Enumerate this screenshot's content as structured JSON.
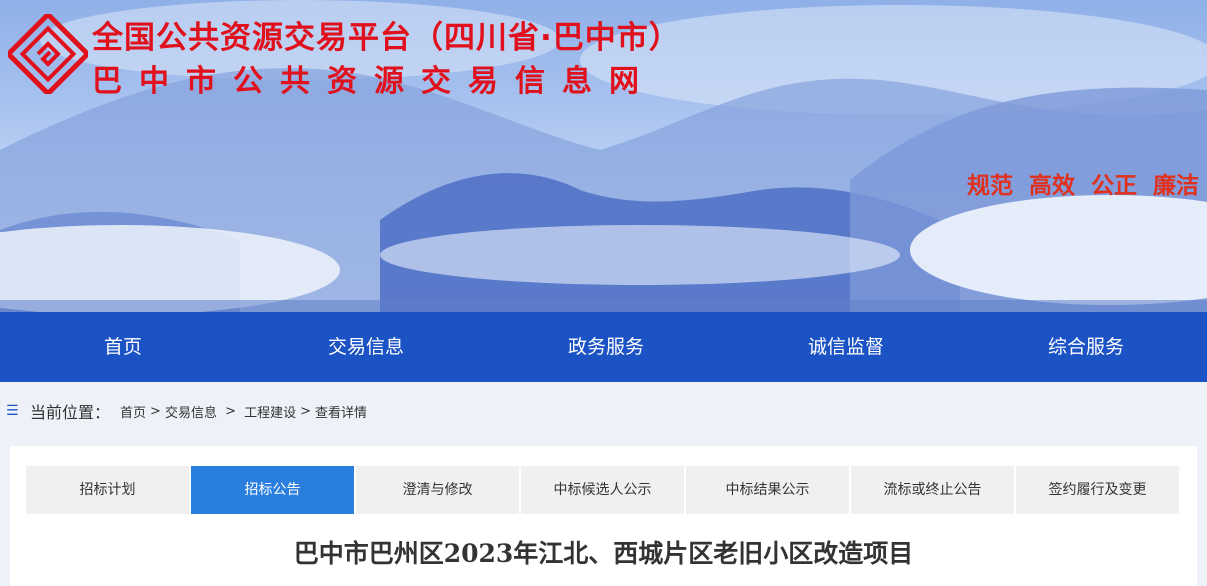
{
  "header": {
    "title": "全国公共资源交易平台（四川省·巴中市）",
    "subtitle": "巴中市公共资源交易信息网",
    "slogans": [
      "规范",
      "高效",
      "公正",
      "廉洁"
    ]
  },
  "nav": {
    "items": [
      "首页",
      "交易信息",
      "政务服务",
      "诚信监督",
      "综合服务"
    ]
  },
  "breadcrumb": {
    "label": "当前位置：",
    "items": [
      "首页",
      "交易信息",
      "工程建设",
      "查看详情"
    ]
  },
  "tabs": {
    "items": [
      "招标计划",
      "招标公告",
      "澄清与修改",
      "中标候选人公示",
      "中标结果公示",
      "流标或终止公告",
      "签约履行及变更"
    ],
    "active": "招标公告"
  },
  "article": {
    "title": "巴中市巴州区2023年江北、西城片区老旧小区改造项目"
  },
  "colors": {
    "brand_red": "#e0101c",
    "nav_blue": "#1b52c4",
    "tab_active": "#2a7ede"
  },
  "icons": [
    "logo-emblem",
    "list-icon"
  ]
}
